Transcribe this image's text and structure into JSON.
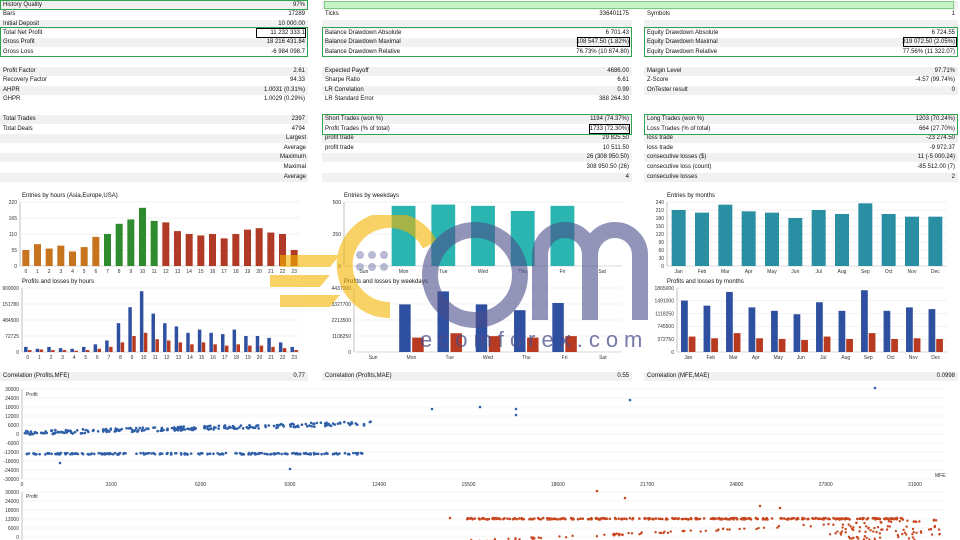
{
  "col1": {
    "rows": [
      {
        "label": "History Quality",
        "value": "97%"
      },
      {
        "label": "Bars",
        "value": "17289"
      },
      {
        "label": "Initial Deposit",
        "value": "10 000.00"
      },
      {
        "label": "Total Net Profit",
        "value": "11 232 333.1"
      },
      {
        "label": "Gross Profit",
        "value": "18 216 431.84"
      },
      {
        "label": "Gross Loss",
        "value": "-6 984 098.7"
      }
    ],
    "rows2": [
      {
        "label": "Profit Factor",
        "value": "2.61"
      },
      {
        "label": "Recovery Factor",
        "value": "94.33"
      },
      {
        "label": "AHPR",
        "value": "1.0031 (0.31%)"
      },
      {
        "label": "GHPR",
        "value": "1.0029 (0.29%)"
      }
    ],
    "rows3": [
      {
        "label": "Total Trades",
        "value": "2397"
      },
      {
        "label": "Total Deals",
        "value": "4794"
      },
      {
        "label": "Largest",
        "value": ""
      },
      {
        "label": "Average",
        "value": ""
      },
      {
        "label": "Maximum",
        "value": ""
      },
      {
        "label": "Maximal",
        "value": ""
      },
      {
        "label": "Average",
        "value": ""
      }
    ]
  },
  "col2": {
    "rows": [
      {
        "label": "",
        "value": ""
      },
      {
        "label": "Ticks",
        "value": "336401175"
      },
      {
        "label": "",
        "value": ""
      },
      {
        "label": "Balance Drawdown Absolute",
        "value": "6 701.43"
      },
      {
        "label": "Balance Drawdown Maximal",
        "value": "108 547.50 (1.82%)"
      },
      {
        "label": "Balance Drawdown Relative",
        "value": "76.73% (10 874.80)"
      }
    ],
    "rows2": [
      {
        "label": "Expected Payoff",
        "value": "4686.00"
      },
      {
        "label": "Sharpe Ratio",
        "value": "6.61"
      },
      {
        "label": "LR Correlation",
        "value": "0.99"
      },
      {
        "label": "LR Standard Error",
        "value": "388 264.30"
      }
    ],
    "rows3": [
      {
        "label": "Short Trades (won %)",
        "value": "1194 (74.37%)"
      },
      {
        "label": "Profit Trades (% of total)",
        "value": "1733 (72.30%)"
      },
      {
        "label": "profit trade",
        "value": "29 825.50"
      },
      {
        "label": "profit trade",
        "value": "10 511.50"
      },
      {
        "label": "",
        "value": "26 (308 950.50)"
      },
      {
        "label": "",
        "value": "308 950.50 (26)"
      },
      {
        "label": "",
        "value": "4"
      }
    ]
  },
  "col3": {
    "rows": [
      {
        "label": "",
        "value": ""
      },
      {
        "label": "Symbols",
        "value": "1"
      },
      {
        "label": "",
        "value": ""
      },
      {
        "label": "Equity Drawdown Absolute",
        "value": "6 724.55"
      },
      {
        "label": "Equity Drawdown Maximal",
        "value": "319 072.50 (2.05%)"
      },
      {
        "label": "Equity Drawdown Relative",
        "value": "77.56% (11 322.07)"
      }
    ],
    "rows2": [
      {
        "label": "Margin Level",
        "value": "97.71%"
      },
      {
        "label": "Z-Score",
        "value": "-4.57 (99.74%)"
      },
      {
        "label": "OnTester result",
        "value": "0"
      },
      {
        "label": "",
        "value": ""
      }
    ],
    "rows3": [
      {
        "label": "Long Trades (won %)",
        "value": "1203 (70.24%)"
      },
      {
        "label": "Loss Trades (% of total)",
        "value": "664 (27.70%)"
      },
      {
        "label": "loss trade",
        "value": "-23 274.50"
      },
      {
        "label": "loss trade",
        "value": "-9 972.37"
      },
      {
        "label": "consecutive losses ($)",
        "value": "11 (-5 000.24)"
      },
      {
        "label": "consecutive loss (count)",
        "value": "-85 512.00 (7)"
      },
      {
        "label": "consecutive losses",
        "value": "2"
      }
    ]
  },
  "colors": {
    "green_box": "#2ea44f",
    "hour_a": "#c8741e",
    "hour_b": "#2e8b2e",
    "hour_c": "#b03a26",
    "week": "#2bb5b0",
    "month": "#2a8fa3",
    "profit_bar": "#2f4fa0",
    "loss_bar": "#b83a20",
    "scatter_blue": "#2f5fa8",
    "scatter_red": "#c8471f"
  },
  "charts": {
    "hours": {
      "title": "Entries by hours (Asia,Europe,USA)",
      "yticks": [
        "0",
        "55",
        "110",
        "165",
        "220"
      ],
      "categories": [
        "0",
        "1",
        "2",
        "3",
        "4",
        "5",
        "6",
        "7",
        "8",
        "9",
        "10",
        "11",
        "12",
        "13",
        "14",
        "15",
        "16",
        "17",
        "18",
        "19",
        "20",
        "21",
        "22",
        "23"
      ],
      "values": [
        55,
        75,
        60,
        70,
        50,
        65,
        100,
        110,
        145,
        160,
        200,
        155,
        150,
        120,
        110,
        105,
        110,
        95,
        110,
        125,
        130,
        115,
        110,
        55
      ]
    },
    "weekdays": {
      "title": "Entries by weekdays",
      "yticks": [
        "0",
        "250",
        "500"
      ],
      "categories": [
        "Sun",
        "Mon",
        "Tue",
        "Wed",
        "Thu",
        "Fri",
        "Sat"
      ],
      "values": [
        0,
        470,
        480,
        470,
        430,
        470,
        0
      ]
    },
    "months": {
      "title": "Entries by months",
      "yticks": [
        "0",
        "30",
        "60",
        "90",
        "120",
        "150",
        "180",
        "210",
        "240"
      ],
      "categories": [
        "Jan",
        "Feb",
        "Mar",
        "Apr",
        "May",
        "Jun",
        "Jul",
        "Aug",
        "Sep",
        "Oct",
        "Nov",
        "Dec"
      ],
      "values": [
        210,
        200,
        230,
        205,
        200,
        180,
        210,
        195,
        235,
        195,
        185,
        185
      ]
    },
    "pl_hours": {
      "title": "Profits and losses by hours",
      "yticks": [
        "0",
        "72725",
        "484500",
        "151780",
        "909000"
      ],
      "categories": [
        "0",
        "1",
        "2",
        "3",
        "4",
        "5",
        "6",
        "7",
        "8",
        "9",
        "10",
        "11",
        "12",
        "13",
        "14",
        "15",
        "16",
        "17",
        "18",
        "19",
        "20",
        "21",
        "22",
        "23"
      ],
      "profit": [
        8,
        5,
        8,
        6,
        5,
        8,
        12,
        18,
        45,
        70,
        95,
        60,
        45,
        40,
        30,
        35,
        30,
        28,
        35,
        25,
        25,
        22,
        15,
        8
      ],
      "loss": [
        3,
        4,
        3,
        3,
        2,
        3,
        5,
        8,
        15,
        25,
        30,
        20,
        18,
        15,
        12,
        15,
        12,
        10,
        12,
        10,
        10,
        8,
        6,
        3
      ]
    },
    "pl_weekdays": {
      "title": "Profits and losses by weekdays",
      "yticks": [
        "0",
        "1108250",
        "2213500",
        "3327700",
        "4437000"
      ],
      "categories": [
        "Sun",
        "Mon",
        "Tue",
        "Wed",
        "Thu",
        "Fri",
        "Sat"
      ],
      "profit": [
        0,
        3300000,
        4200000,
        3300000,
        2900000,
        3400000,
        0
      ],
      "loss": [
        0,
        1000000,
        1300000,
        1100000,
        1000000,
        1100000,
        0
      ]
    },
    "pl_months": {
      "title": "Profits and losses by months",
      "yticks": [
        "0",
        "372750",
        "745500",
        "1118250",
        "1491000",
        "1865000"
      ],
      "categories": [
        "Jan",
        "Feb",
        "Mar",
        "Apr",
        "May",
        "Jun",
        "Jul",
        "Aug",
        "Sep",
        "Oct",
        "Nov",
        "Dec"
      ],
      "profit": [
        1500000,
        1350000,
        1750000,
        1300000,
        1200000,
        1100000,
        1450000,
        1200000,
        1800000,
        1200000,
        1300000,
        1250000
      ],
      "loss": [
        450000,
        400000,
        550000,
        400000,
        380000,
        350000,
        450000,
        380000,
        550000,
        380000,
        400000,
        380000
      ]
    }
  },
  "correlations": [
    {
      "label": "Correlation (Profits,MFE)",
      "value": "0.77"
    },
    {
      "label": "Correlation (Profits,MAE)",
      "value": "0.55"
    },
    {
      "label": "Correlation (MFE,MAE)",
      "value": "0.0998"
    }
  ],
  "scatter1": {
    "ylabel": "Profit",
    "xlabel": "MFE",
    "yticks": [
      "30000",
      "24000",
      "18000",
      "12000",
      "6000",
      "0",
      "-6000",
      "-12000",
      "-18000",
      "-24000",
      "-30000"
    ],
    "xticks": [
      "0",
      "3100",
      "6200",
      "9300",
      "12400",
      "15500",
      "18600",
      "21700",
      "24800",
      "27900",
      "31000"
    ]
  },
  "scatter2": {
    "ylabel": "Profit",
    "yticks": [
      "30000",
      "24000",
      "18000",
      "12000",
      "6000",
      "0"
    ]
  },
  "watermark": {
    "text": "ecomforex.com"
  }
}
